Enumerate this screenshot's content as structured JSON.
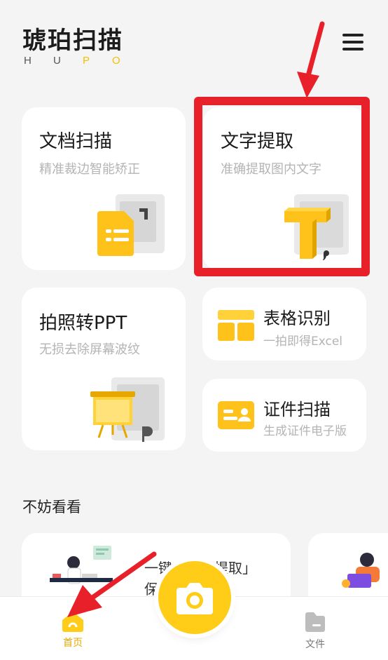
{
  "header": {
    "title": "琥珀扫描",
    "subtitle_letters": [
      "H",
      "U",
      "P",
      "O"
    ]
  },
  "cards": {
    "doc_scan": {
      "title": "文档扫描",
      "subtitle": "精准裁边智能矫正"
    },
    "text_extract": {
      "title": "文字提取",
      "subtitle": "准确提取图内文字"
    },
    "photo_ppt": {
      "title": "拍照转PPT",
      "subtitle": "无损去除屏幕波纹"
    },
    "table_recog": {
      "title": "表格识别",
      "subtitle": "一拍即得Excel"
    },
    "id_scan": {
      "title": "证件扫描",
      "subtitle": "生成证件电子版"
    }
  },
  "section": {
    "label": "不妨看看"
  },
  "promo": {
    "line1": "一键「文字提取」",
    "line2": "保存"
  },
  "tabs": {
    "home": "首页",
    "files": "文件"
  },
  "colors": {
    "accent": "#ffcc18",
    "highlight": "#e8202a",
    "arrow": "#e8202a"
  }
}
